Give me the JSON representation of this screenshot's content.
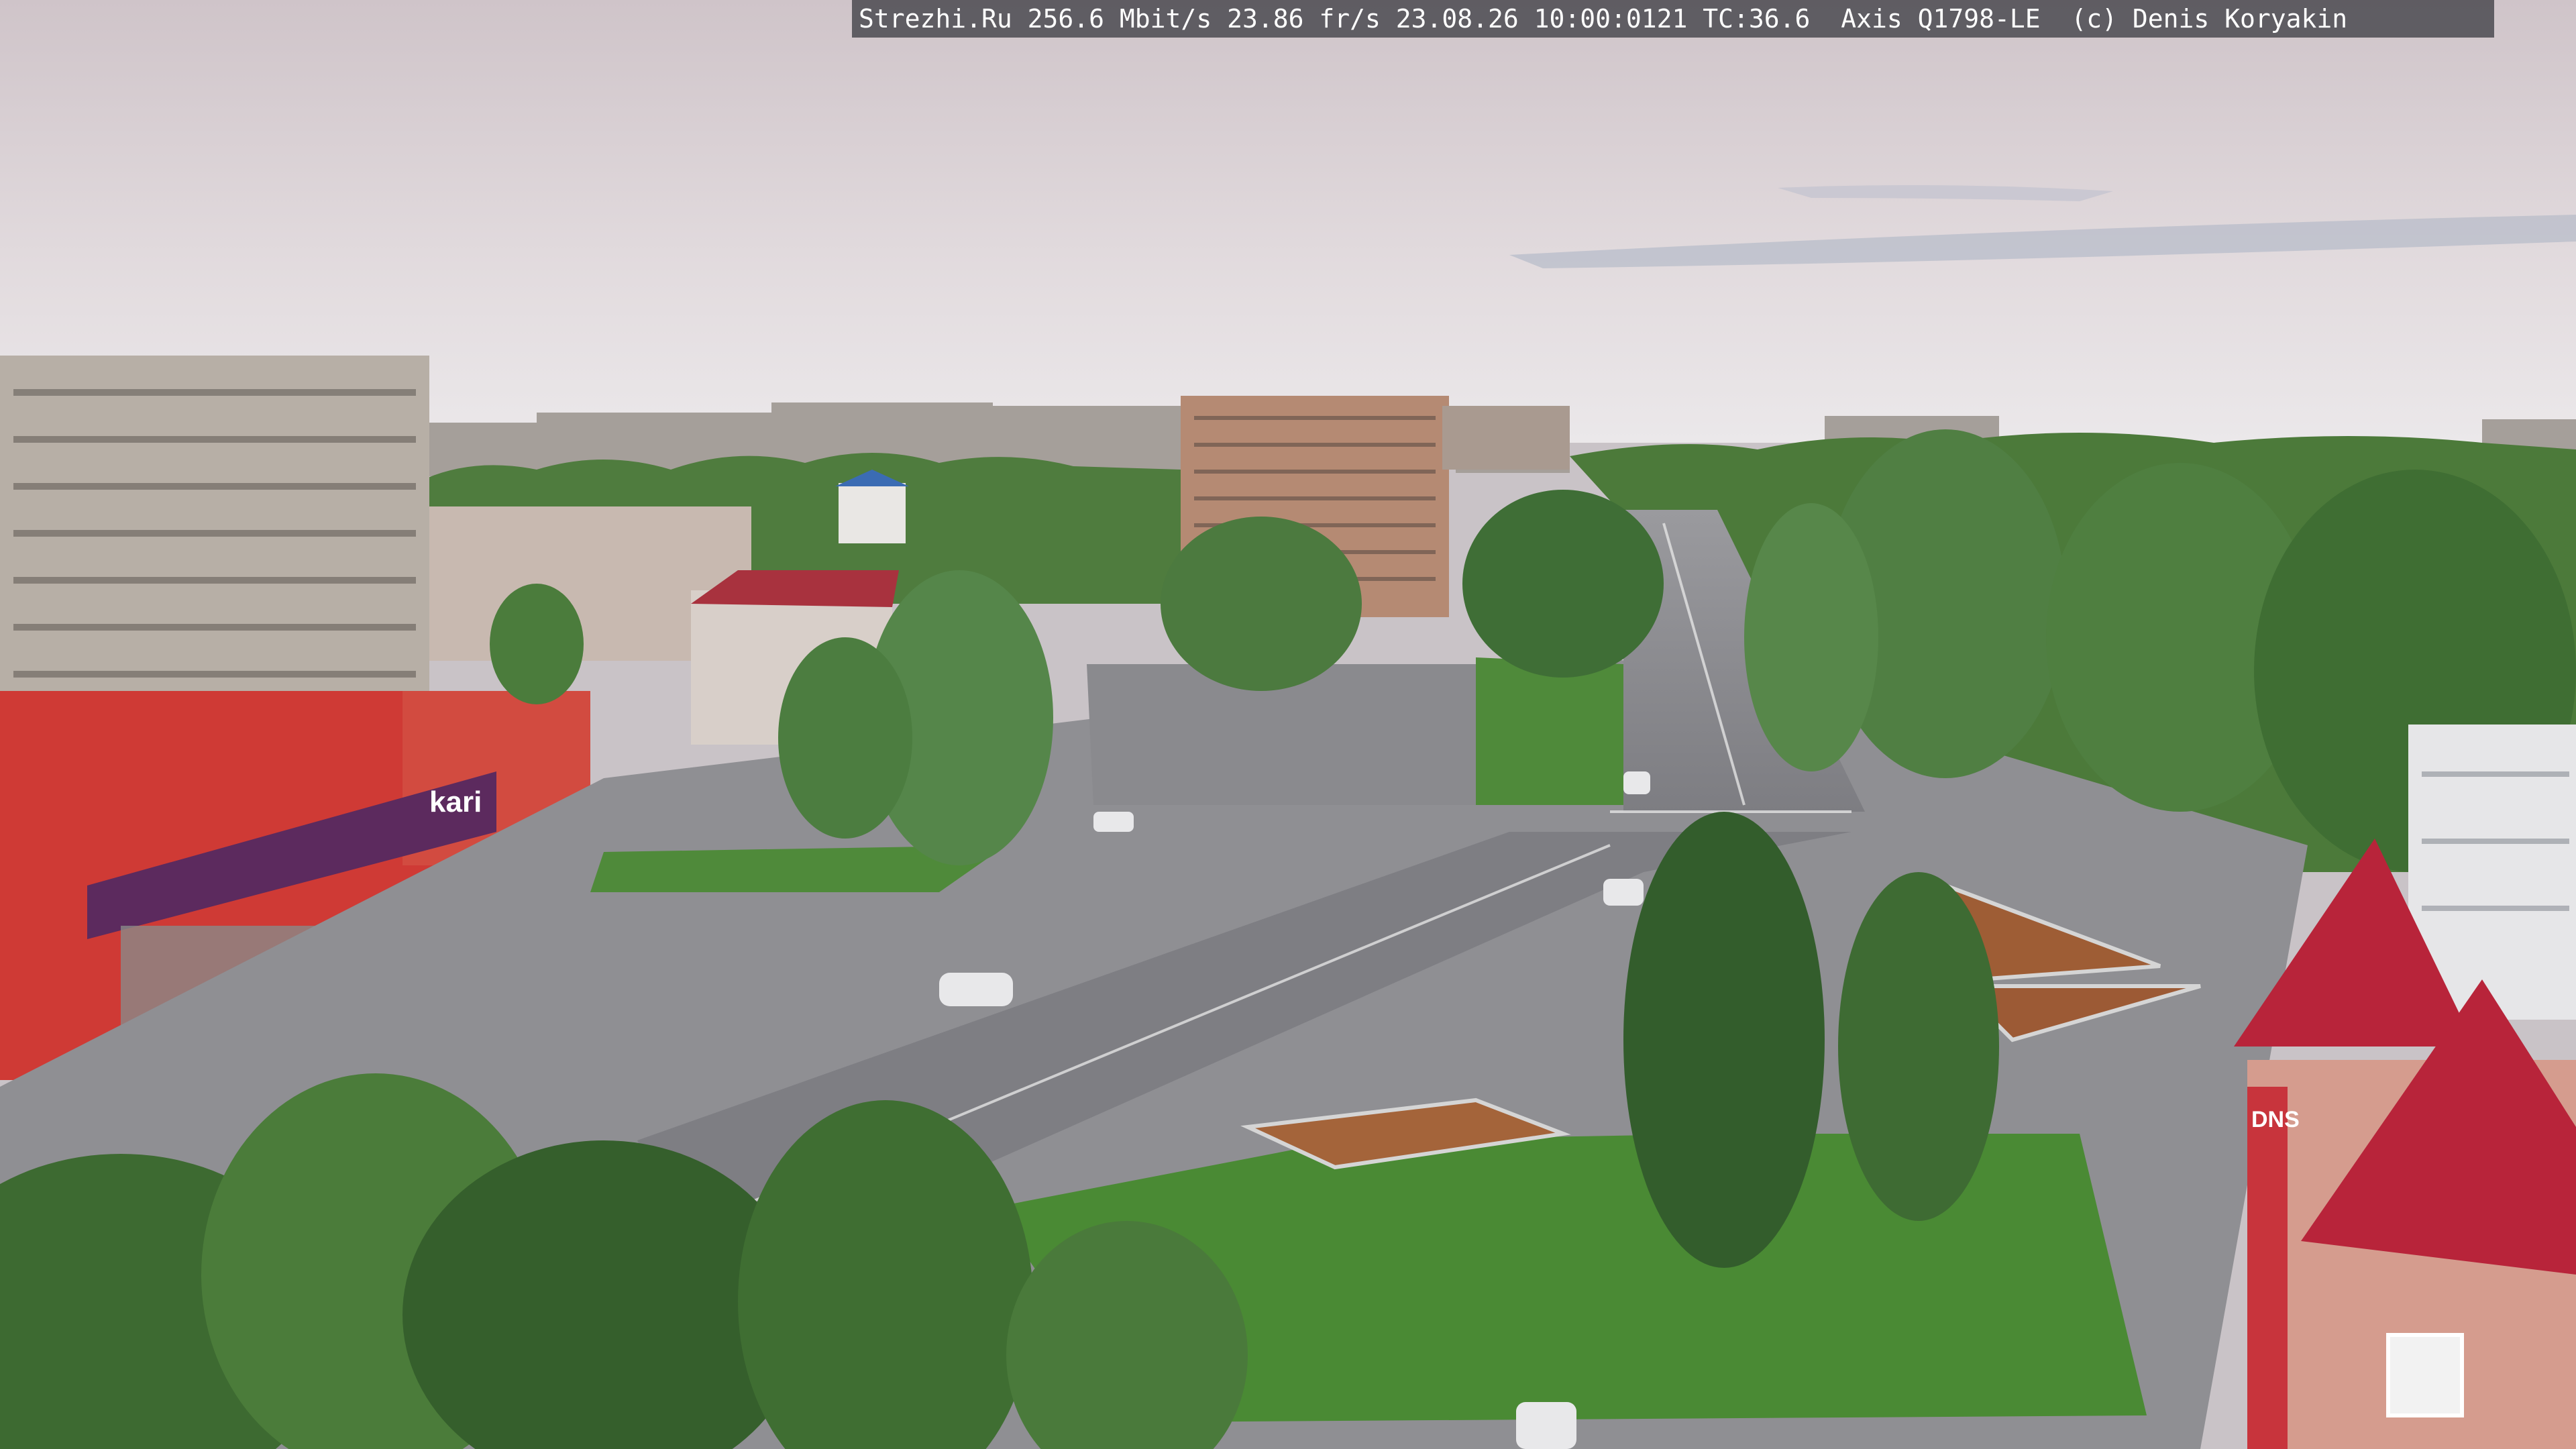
{
  "overlay": {
    "text": "Strezhi.Ru 256.6 Mbit/s 23.86 fr/s 23.08.26 10:00:0121 TC:36.6  Axis Q1798-LE  (c) Denis Koryakin"
  },
  "signs": {
    "store_brand": "kari",
    "tower_sign": "DNS"
  },
  "colors": {
    "sky_top": "#d6cdd0",
    "sky_horizon": "#e9e4e6",
    "road": "#8c8c90",
    "grass": "#4f8a3a",
    "tree_dark": "#2f5a2a",
    "tree_light": "#5e8f45",
    "roof_red": "#b8243a",
    "store_red": "#cf3a35",
    "store_purple": "#5c2a5e"
  }
}
